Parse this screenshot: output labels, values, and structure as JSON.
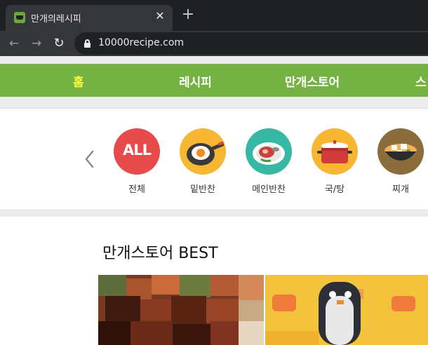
{
  "browser": {
    "tab_title": "만개의레시피",
    "tab_close": "✕",
    "new_tab": "+",
    "back": "←",
    "forward": "→",
    "reload": "↻",
    "url": "10000recipe.com"
  },
  "nav": {
    "items": [
      {
        "label": "홈",
        "active": true
      },
      {
        "label": "레시피"
      },
      {
        "label": "만개스토어"
      },
      {
        "label": "스"
      }
    ],
    "accent": "#74b243",
    "active_color": "#fffe3c"
  },
  "categories": [
    {
      "label": "전체",
      "badge": "ALL",
      "icon": "all-icon",
      "color": "#e74a4a"
    },
    {
      "label": "밑반찬",
      "icon": "fried-egg-pan-icon",
      "color": "#f7b733"
    },
    {
      "label": "메인반찬",
      "icon": "meat-plate-icon",
      "color": "#35b9a5"
    },
    {
      "label": "국/탕",
      "icon": "soup-pot-icon",
      "color": "#f7b733"
    },
    {
      "label": "찌개",
      "icon": "stew-bowl-icon",
      "color": "#8a6d3b"
    }
  ],
  "best": {
    "title": "만개스토어 BEST"
  }
}
